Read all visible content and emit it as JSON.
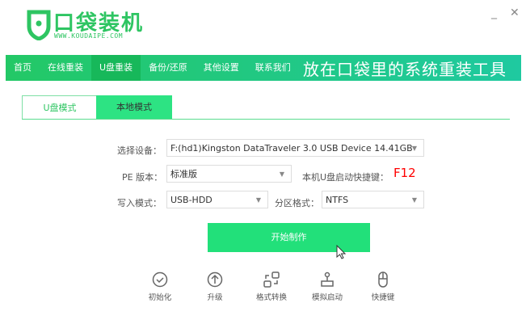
{
  "app": {
    "name": "口袋装机",
    "url": "WWW.KOUDAIPE.COM",
    "slogan": "放在口袋里的系统重装工具"
  },
  "window": {
    "minimize": "_",
    "close": "✕"
  },
  "nav": [
    {
      "label": "首页"
    },
    {
      "label": "在线重装"
    },
    {
      "label": "U盘重装",
      "active": true
    },
    {
      "label": "备份/还原"
    },
    {
      "label": "其他设置"
    },
    {
      "label": "联系我们"
    }
  ],
  "tabs": [
    {
      "label": "U盘模式",
      "active": true
    },
    {
      "label": "本地模式"
    }
  ],
  "form": {
    "device_label": "选择设备：",
    "device_value": "F:(hd1)Kingston DataTraveler 3.0 USB Device 14.41GB",
    "pe_label": "PE 版本：",
    "pe_value": "标准版",
    "hotkey_label": "本机U盘启动快捷键：",
    "hotkey_value": "F12",
    "write_label": "写入模式：",
    "write_value": "USB-HDD",
    "partition_label": "分区格式：",
    "partition_value": "NTFS"
  },
  "start_button": "开始制作",
  "tools": [
    {
      "label": "初始化",
      "icon": "check-circle-icon"
    },
    {
      "label": "升级",
      "icon": "arrow-up-circle-icon"
    },
    {
      "label": "格式转换",
      "icon": "convert-icon"
    },
    {
      "label": "模拟启动",
      "icon": "stamp-icon"
    },
    {
      "label": "快捷键",
      "icon": "mouse-icon"
    }
  ],
  "colors": {
    "accent": "#2ec562",
    "hotkey": "#ff0000"
  }
}
